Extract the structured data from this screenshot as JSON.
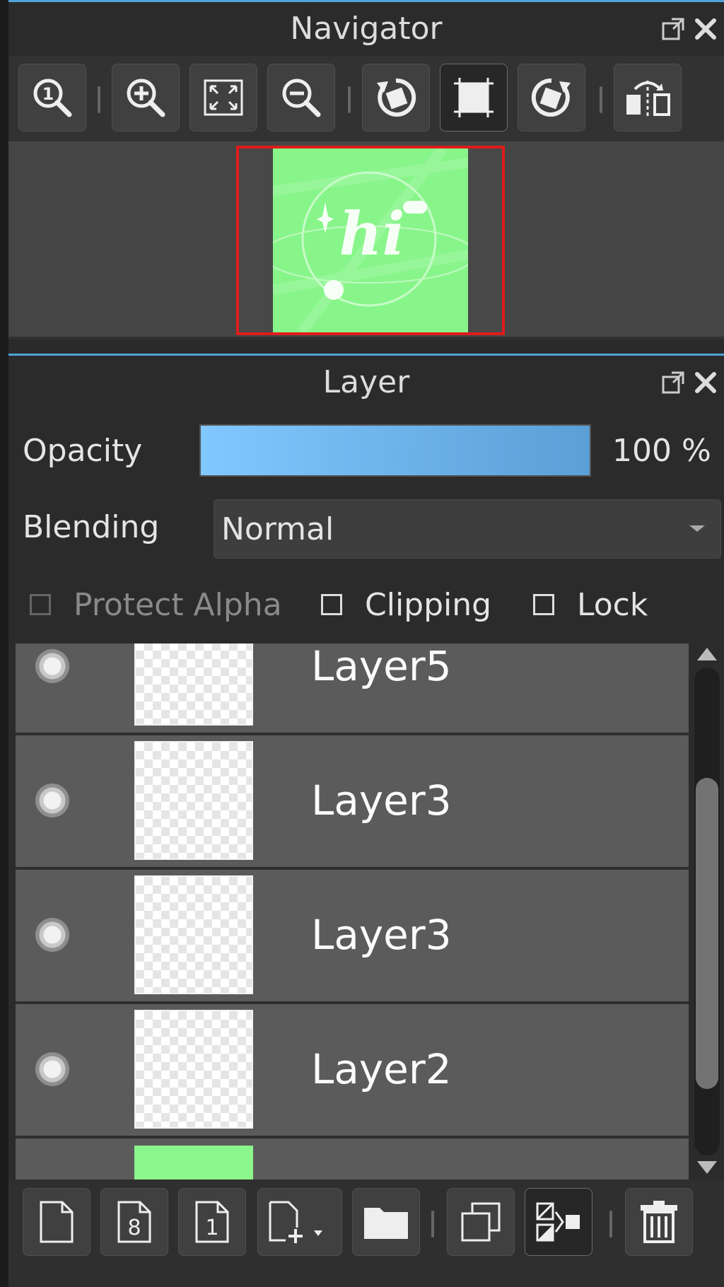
{
  "navigator": {
    "title": "Navigator",
    "toolbar": [
      {
        "name": "zoom-actual-size-icon",
        "label": "1"
      },
      {
        "name": "zoom-in-icon"
      },
      {
        "name": "fit-to-window-icon"
      },
      {
        "name": "zoom-out-icon"
      },
      {
        "name": "rotate-left-icon"
      },
      {
        "name": "reset-rotation-icon"
      },
      {
        "name": "rotate-right-icon"
      },
      {
        "name": "flip-horizontal-icon"
      }
    ],
    "preview_text": "hi",
    "frame_color": "#e01b1b",
    "canvas_color": "#88f58a"
  },
  "layer_panel": {
    "title": "Layer",
    "opacity_label": "Opacity",
    "opacity_value": "100 %",
    "opacity_level": 1.0,
    "blending_label": "Blending",
    "blending_value": "Normal",
    "protect_alpha_label": "Protect Alpha",
    "clipping_label": "Clipping",
    "lock_label": "Lock",
    "layers": [
      {
        "name": "Layer5",
        "visible": true
      },
      {
        "name": "Layer3",
        "visible": true
      },
      {
        "name": "Layer3",
        "visible": true
      },
      {
        "name": "Layer2",
        "visible": true
      },
      {
        "name": "",
        "visible": true,
        "thumb": "green"
      }
    ],
    "bottom_tools": [
      {
        "name": "new-layer-icon"
      },
      {
        "name": "new-8bit-layer-icon",
        "label": "8"
      },
      {
        "name": "new-1bit-layer-icon",
        "label": "1"
      },
      {
        "name": "add-layer-menu-icon"
      },
      {
        "name": "new-folder-icon"
      },
      {
        "name": "duplicate-layer-icon"
      },
      {
        "name": "merge-down-icon"
      },
      {
        "name": "delete-layer-icon"
      }
    ],
    "accent_color": "#4fa3d9"
  }
}
